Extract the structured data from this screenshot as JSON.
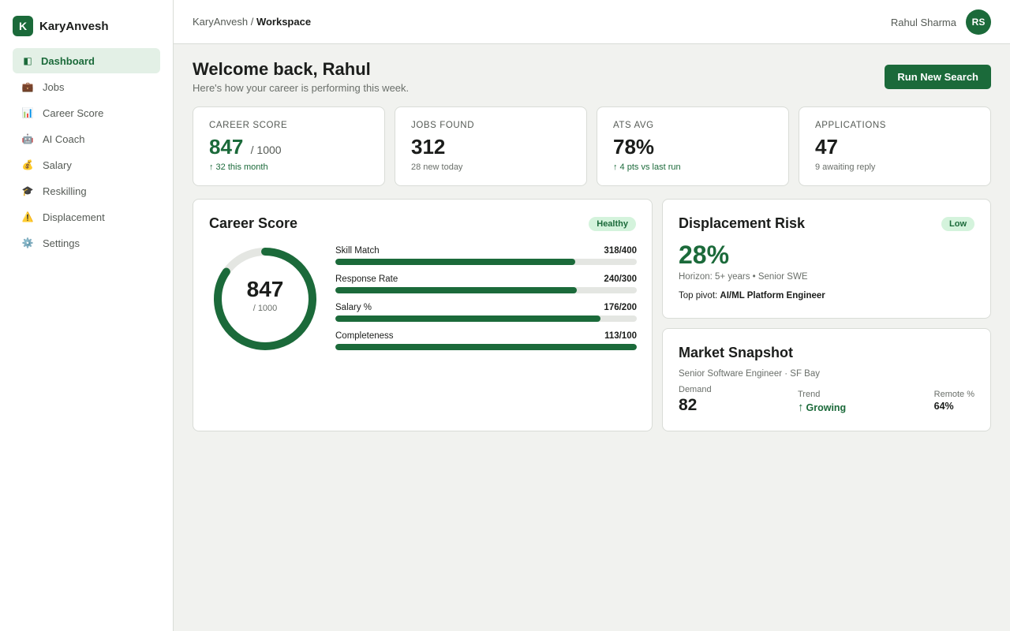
{
  "brand": {
    "logo_letter": "K",
    "name": "KaryAnvesh"
  },
  "nav": {
    "items": [
      {
        "label": "Dashboard",
        "icon": "dashboard-icon",
        "glyph": "◧",
        "active": true
      },
      {
        "label": "Jobs",
        "icon": "briefcase-icon",
        "glyph": "💼",
        "active": false
      },
      {
        "label": "Career Score",
        "icon": "bar-chart-icon",
        "glyph": "📊",
        "active": false
      },
      {
        "label": "AI Coach",
        "icon": "robot-icon",
        "glyph": "🤖",
        "active": false
      },
      {
        "label": "Salary",
        "icon": "money-bag-icon",
        "glyph": "💰",
        "active": false
      },
      {
        "label": "Reskilling",
        "icon": "graduation-cap-icon",
        "glyph": "🎓",
        "active": false
      },
      {
        "label": "Displacement",
        "icon": "warning-icon",
        "glyph": "⚠️",
        "active": false
      },
      {
        "label": "Settings",
        "icon": "gear-icon",
        "glyph": "⚙️",
        "active": false
      }
    ]
  },
  "topbar": {
    "breadcrumb_root": "KaryAnvesh",
    "breadcrumb_sep": " / ",
    "breadcrumb_current": "Workspace",
    "user_name": "Rahul Sharma",
    "avatar_initials": "RS"
  },
  "welcome": {
    "title": "Welcome back, Rahul",
    "subtitle": "Here's how your career is performing this week.",
    "cta_label": "Run New Search"
  },
  "stats": [
    {
      "label": "CAREER SCORE",
      "value": "847",
      "denom": "/ 1000",
      "sub": "↑ 32 this month",
      "value_green": true,
      "sub_green": true
    },
    {
      "label": "JOBS FOUND",
      "value": "312",
      "denom": "",
      "sub": "28 new today",
      "value_green": false,
      "sub_green": false
    },
    {
      "label": "ATS AVG",
      "value": "78%",
      "denom": "",
      "sub": "↑ 4 pts vs last run",
      "value_green": false,
      "sub_green": true
    },
    {
      "label": "APPLICATIONS",
      "value": "47",
      "denom": "",
      "sub": "9 awaiting reply",
      "value_green": false,
      "sub_green": false
    }
  ],
  "career_score": {
    "title": "Career Score",
    "badge": "Healthy",
    "score": "847",
    "score_denom": "/ 1000",
    "score_fraction": 0.847,
    "components": [
      {
        "label": "Skill Match",
        "value": "318/400",
        "fraction": 0.795
      },
      {
        "label": "Response Rate",
        "value": "240/300",
        "fraction": 0.8
      },
      {
        "label": "Salary %",
        "value": "176/200",
        "fraction": 0.88
      },
      {
        "label": "Completeness",
        "value": "113/100",
        "fraction": 1.0
      }
    ]
  },
  "displacement": {
    "title": "Displacement Risk",
    "badge": "Low",
    "percent": "28%",
    "horizon": "Horizon: 5+ years • Senior SWE",
    "pivot_label": "Top pivot: ",
    "pivot_value": "AI/ML Platform Engineer"
  },
  "market": {
    "title": "Market Snapshot",
    "subtitle": "Senior Software Engineer · SF Bay",
    "demand_label": "Demand",
    "demand_value": "82",
    "trend_label": "Trend",
    "trend_arrow": "↑",
    "trend_value": "Growing",
    "remote_label": "Remote %",
    "remote_value": "64%"
  },
  "colors": {
    "accent": "#1b6a3a",
    "accent_soft": "#e3f0e6",
    "badge_bg": "#d4f3dc",
    "track": "#e4e6e2"
  }
}
